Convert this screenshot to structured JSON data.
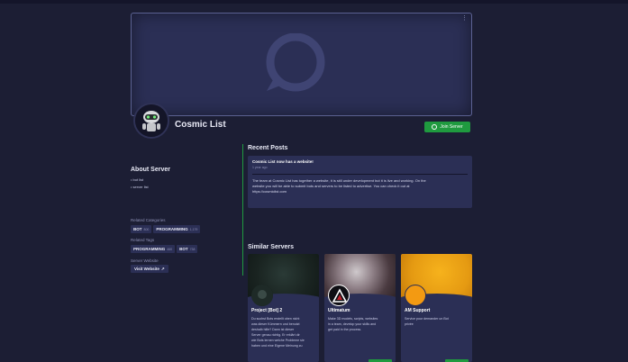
{
  "server": {
    "name": "Cosmic List",
    "join_label": "Join Server"
  },
  "about": {
    "title": "About Server",
    "items": [
      "bot list",
      "server list"
    ]
  },
  "categories": {
    "label": "Related Categories",
    "tags": [
      {
        "name": "BOT",
        "count": "800"
      },
      {
        "name": "PROGRAMMING",
        "count": "1,179"
      }
    ]
  },
  "related_tags": {
    "label": "Related Tags",
    "tags": [
      {
        "name": "PROGRAMMING",
        "count": "460"
      },
      {
        "name": "BOT",
        "count": "738"
      }
    ]
  },
  "website": {
    "label": "Server Website",
    "button": "Visit Website"
  },
  "recent_posts": {
    "title": "Recent Posts",
    "posts": [
      {
        "title": "Cosmic List now has a website!",
        "time": "1 year ago",
        "lines": [
          "The team at Cosmic List has together a website, it is still under development but it is live and working. On the",
          "website you will be able to submit bots and servers to be listed to advertise. You can check it out at",
          "https://cosmiclist.com"
        ]
      }
    ]
  },
  "similar": {
    "title": "Similar Servers",
    "cards": [
      {
        "name": "Project [Bot] 2",
        "desc": [
          "Du suchst Bots erstellt oben nicht",
          "was dieser Kümmern und benutzt",
          "deshalb hilfe? Dann ist dieser",
          "Server genau richtig. Er erklärt dir",
          "wie Bots lernen welche Probleme sie",
          "haben und eine Eigene Meinung zu"
        ]
      },
      {
        "name": "Ultimatum",
        "desc": [
          "Make 3D models, scripts, websites",
          "in a team, develop your skills and",
          "get paid in the process."
        ]
      },
      {
        "name": "AM Support",
        "desc": [
          "Service pour demander un Bot",
          "privée"
        ]
      }
    ]
  },
  "colors": {
    "background": "#1c1e34",
    "card": "#2b2f55",
    "accent_green": "#1f9a3f"
  },
  "icons": {
    "banner": "chat-bubble-icon",
    "join": "plus-circle-icon",
    "visit": "external-link-icon",
    "menu": "vertical-dots-icon"
  }
}
